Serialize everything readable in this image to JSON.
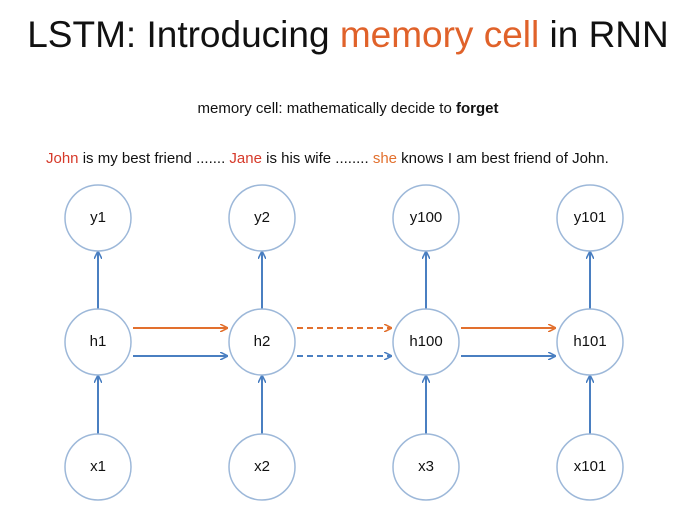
{
  "title": {
    "pre": "LSTM: Introducing ",
    "highlight": "memory cell",
    "post": " in RNN"
  },
  "subtitle": {
    "pre": "memory cell: mathematically decide to ",
    "bold": "forget"
  },
  "sentence": {
    "w1": "John",
    "t1": " is my best friend ....... ",
    "w2": "Jane",
    "t2": " is his wife ........ ",
    "w3": "she",
    "t3": " knows I am best friend of John."
  },
  "nodes": {
    "y": [
      "y1",
      "y2",
      "y100",
      "y101"
    ],
    "h": [
      "h1",
      "h2",
      "h100",
      "h101"
    ],
    "x": [
      "x1",
      "x2",
      "x3",
      "x101"
    ]
  },
  "colors": {
    "orange": "#e2702e",
    "blue": "#4a7fc1",
    "circle": "#9db8d9"
  },
  "links": [
    {
      "from": 0,
      "to": 1,
      "dashed": false
    },
    {
      "from": 1,
      "to": 2,
      "dashed": true
    },
    {
      "from": 2,
      "to": 3,
      "dashed": false
    }
  ]
}
